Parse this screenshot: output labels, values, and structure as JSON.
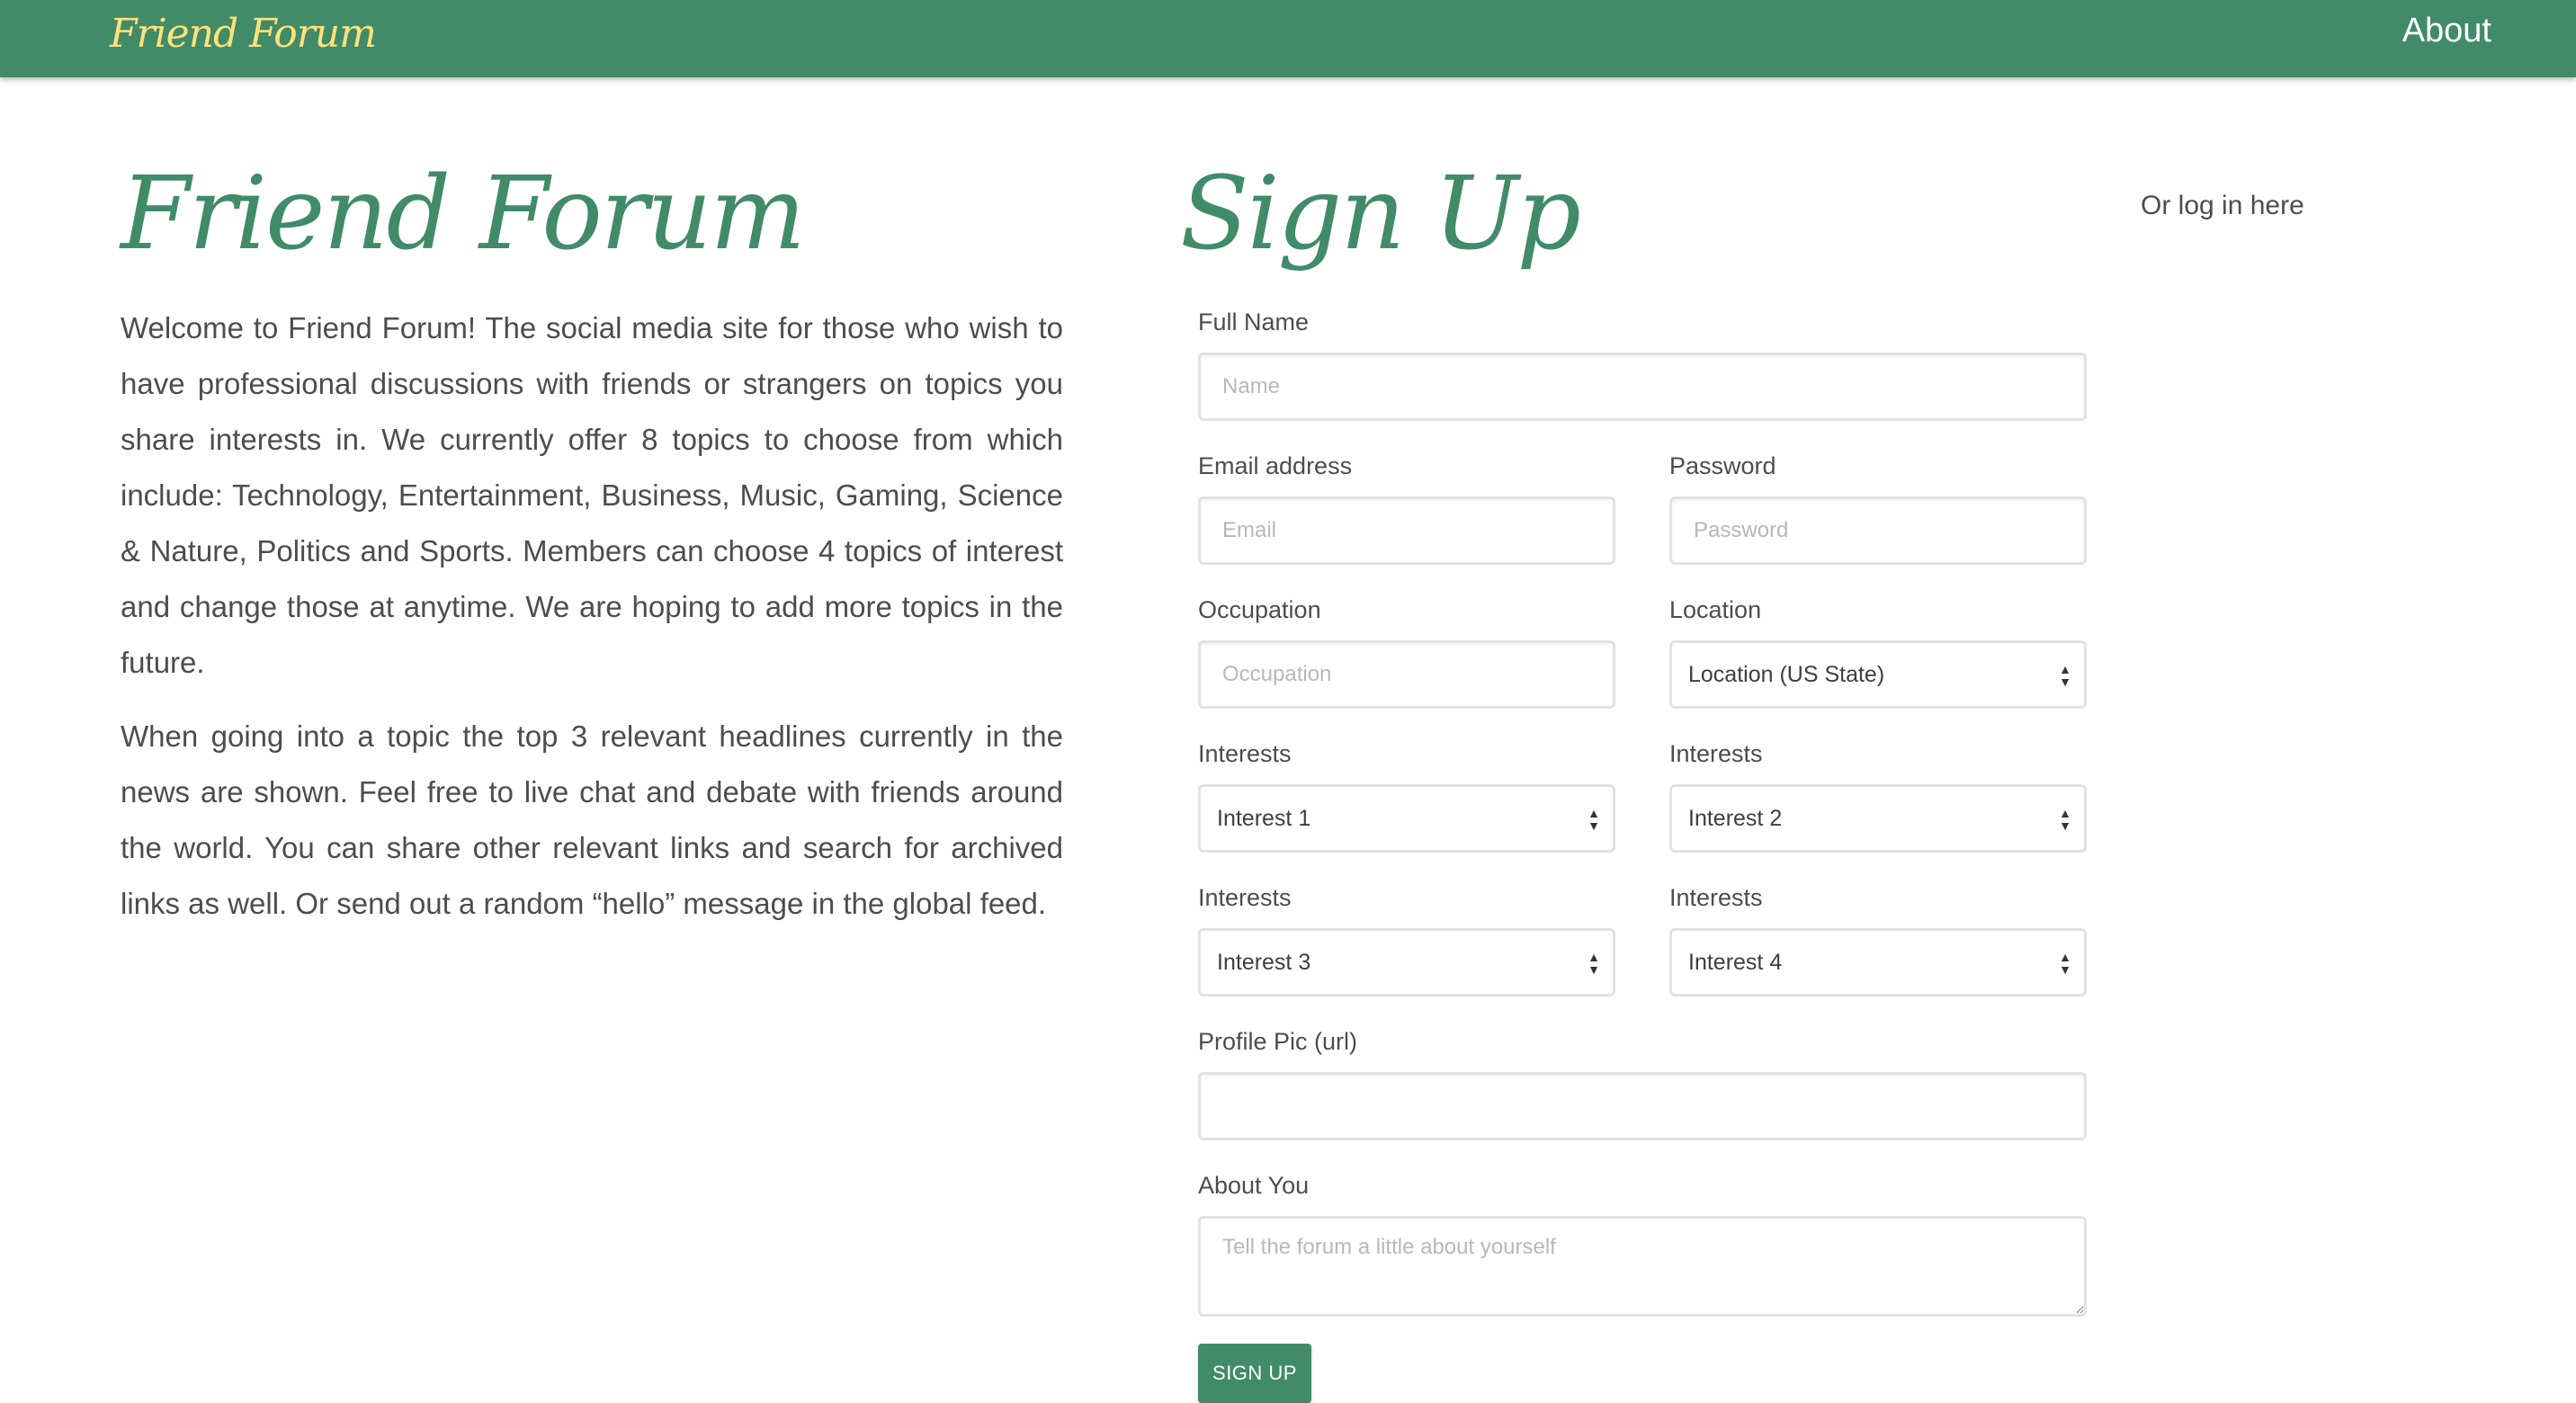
{
  "navbar": {
    "brand": "Friend Forum",
    "about": "About"
  },
  "hero": {
    "title": "Friend Forum",
    "paragraphs": [
      "Welcome to Friend Forum! The social media site for those who wish to have professional discussions with friends or strangers on topics you share interests in. We currently offer 8 topics to choose from which include: Technology, Entertainment, Business, Music, Gaming, Science & Nature, Politics and Sports. Members can choose 4 topics of interest and change those at anytime. We are hoping to add more topics in the future.",
      "When going into a topic the top 3 relevant headlines currently in the news are shown. Feel free to live chat and debate with friends around the world. You can share other relevant links and search for archived links as well. Or send out a random “hello” message in the global feed."
    ]
  },
  "signup": {
    "title": "Sign Up",
    "login_link": "Or log in here",
    "full_name": {
      "label": "Full Name",
      "placeholder": "Name"
    },
    "email": {
      "label": "Email address",
      "placeholder": "Email"
    },
    "password": {
      "label": "Password",
      "placeholder": "Password"
    },
    "occupation": {
      "label": "Occupation",
      "placeholder": "Occupation"
    },
    "location": {
      "label": "Location",
      "value": "Location (US State)"
    },
    "interest1": {
      "label": "Interests",
      "value": "Interest 1"
    },
    "interest2": {
      "label": "Interests",
      "value": "Interest 2"
    },
    "interest3": {
      "label": "Interests",
      "value": "Interest 3"
    },
    "interest4": {
      "label": "Interests",
      "value": "Interest 4"
    },
    "profile_pic": {
      "label": "Profile Pic (url)",
      "placeholder": ""
    },
    "about": {
      "label": "About You",
      "placeholder": "Tell the forum a little about yourself"
    },
    "submit": "SIGN UP"
  }
}
